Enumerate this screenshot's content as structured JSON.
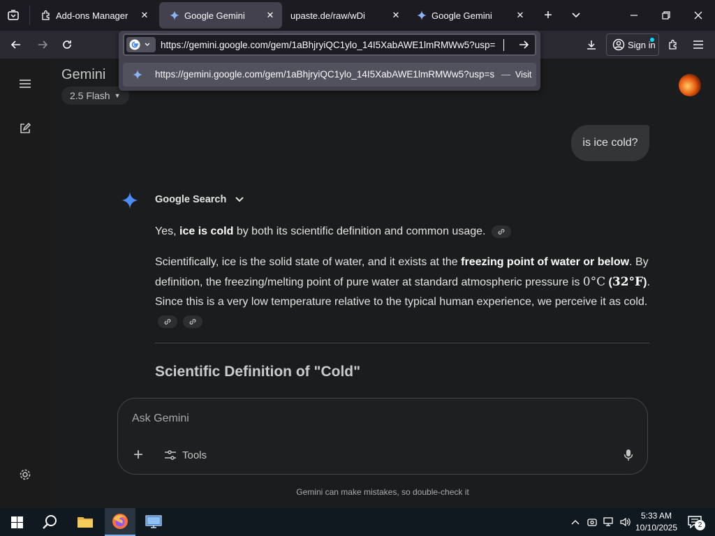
{
  "browser": {
    "tabs": [
      {
        "title": "Add-ons Manager",
        "icon": "puzzle-icon"
      },
      {
        "title": "Google Gemini",
        "icon": "gemini-icon",
        "active": true
      },
      {
        "title": "upaste.de/raw/wDi",
        "icon": ""
      },
      {
        "title": "Google Gemini",
        "icon": "gemini-icon"
      }
    ],
    "url": "https://gemini.google.com/gem/1aBhjryiQC1ylo_14I5XabAWE1lmRMWw5?usp=",
    "suggestion_url": "https://gemini.google.com/gem/1aBhjryiQC1ylo_14I5XabAWE1lmRMWw5?usp=s",
    "suggestion_sep": "—",
    "suggestion_action": "Visit",
    "sign_in": "Sign in"
  },
  "gemini": {
    "title": "Gemini",
    "model": "2.5 Flash",
    "user_message": "is ice cold?",
    "source_label": "Google Search",
    "p1_pre": "Yes, ",
    "p1_bold": "ice is cold",
    "p1_post": " by both its scientific definition and common usage.",
    "p2_a": "Scientifically, ice is the solid state of water, and it exists at the ",
    "p2_bold1": "freezing point of water or below",
    "p2_b": ". By definition, the freezing/melting point of pure water at standard atmospheric pressure is ",
    "p2_math1": "0°C",
    "p2_bold2_pre": " (",
    "p2_math2": "32°F",
    "p2_bold2_post": ")",
    "p2_c": ". Since this is a very low temperature relative to the typical human experience, we perceive it as cold.",
    "heading": "Scientific Definition of \"Cold\"",
    "input_placeholder": "Ask Gemini",
    "tools_label": "Tools",
    "disclaimer": "Gemini can make mistakes, so double-check it"
  },
  "taskbar": {
    "time": "5:33 AM",
    "date": "10/10/2025",
    "notification_count": "2"
  },
  "colors": {
    "accent": "#4c8df6",
    "link_chip": "#2d2e30"
  }
}
